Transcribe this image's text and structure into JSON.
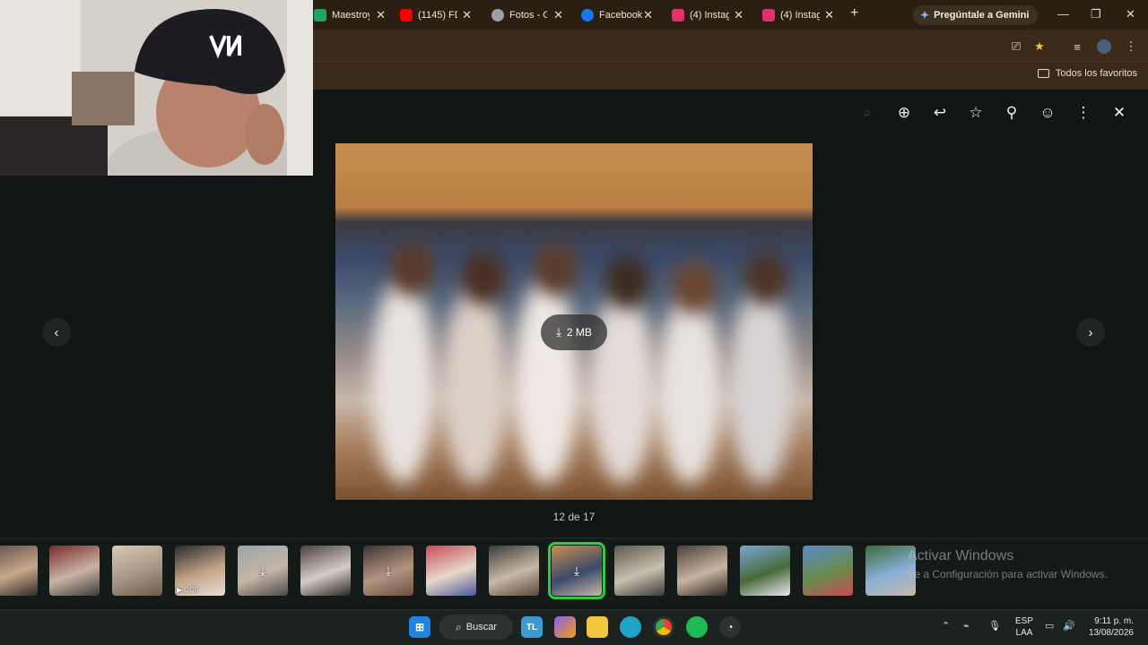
{
  "browser": {
    "tabs": [
      {
        "title": "Maestroy",
        "icon": "green-x-icon",
        "color": "#1fa463"
      },
      {
        "title": "(1145) FD",
        "icon": "youtube-icon",
        "color": "#ff0000"
      },
      {
        "title": "Fotos - G",
        "icon": "globe-icon",
        "color": "#9aa0a6"
      },
      {
        "title": "Facebook",
        "icon": "facebook-icon",
        "color": "#1877f2"
      },
      {
        "title": "(4) Instag",
        "icon": "instagram-icon",
        "color": "#e1306c"
      },
      {
        "title": "(4) Instag",
        "icon": "instagram-icon",
        "color": "#e1306c"
      }
    ],
    "gemini_label": "Pregúntale a Gemini",
    "bookmarks_label": "Todos los favoritos"
  },
  "viewer": {
    "download_label": "2 MB",
    "counter": "12 de 17",
    "accent": "#2ecc40"
  },
  "thumbnails": [
    {
      "has_download": false,
      "duration": ""
    },
    {
      "has_download": false,
      "duration": ""
    },
    {
      "has_download": false,
      "duration": ""
    },
    {
      "has_download": false,
      "duration": "0:05"
    },
    {
      "has_download": true,
      "duration": ""
    },
    {
      "has_download": false,
      "duration": ""
    },
    {
      "has_download": true,
      "duration": ""
    },
    {
      "has_download": false,
      "duration": ""
    },
    {
      "has_download": false,
      "duration": ""
    },
    {
      "has_download": true,
      "duration": "",
      "selected": true
    },
    {
      "has_download": false,
      "duration": ""
    },
    {
      "has_download": false,
      "duration": ""
    },
    {
      "has_download": false,
      "duration": ""
    },
    {
      "has_download": false,
      "duration": ""
    },
    {
      "has_download": false,
      "duration": ""
    }
  ],
  "watermark": {
    "title": "Activar Windows",
    "subtitle": "Ve a Configuración para activar Windows."
  },
  "taskbar": {
    "search_label": "Buscar",
    "lang_line1": "ESP",
    "lang_line2": "LAA",
    "time": "9:11 p. m.",
    "date": "13/08/2026"
  }
}
